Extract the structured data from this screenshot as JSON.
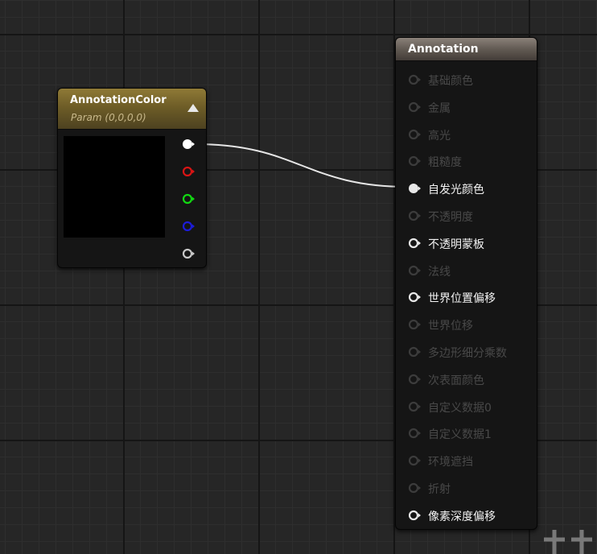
{
  "param_node": {
    "title": "AnnotationColor",
    "subtitle": "Param (0,0,0,0)",
    "preview_color": "#000000",
    "output_pins": [
      {
        "name": "rgba",
        "color": "#ffffff"
      },
      {
        "name": "r",
        "color": "#d81414"
      },
      {
        "name": "g",
        "color": "#12d812"
      },
      {
        "name": "b",
        "color": "#1c1cd8"
      },
      {
        "name": "a",
        "color": "#c8c8c8"
      }
    ]
  },
  "result_node": {
    "title": "Annotation",
    "inputs": [
      {
        "label": "基础颜色",
        "state": "disabled"
      },
      {
        "label": "金属",
        "state": "disabled"
      },
      {
        "label": "高光",
        "state": "disabled"
      },
      {
        "label": "粗糙度",
        "state": "disabled"
      },
      {
        "label": "自发光颜色",
        "state": "connected"
      },
      {
        "label": "不透明度",
        "state": "disabled"
      },
      {
        "label": "不透明蒙板",
        "state": "enabled"
      },
      {
        "label": "法线",
        "state": "disabled"
      },
      {
        "label": "世界位置偏移",
        "state": "enabled"
      },
      {
        "label": "世界位移",
        "state": "disabled"
      },
      {
        "label": "多边形细分乘数",
        "state": "disabled"
      },
      {
        "label": "次表面颜色",
        "state": "disabled"
      },
      {
        "label": "自定义数据0",
        "state": "disabled"
      },
      {
        "label": "自定义数据1",
        "state": "disabled"
      },
      {
        "label": "环境遮挡",
        "state": "disabled"
      },
      {
        "label": "折射",
        "state": "disabled"
      },
      {
        "label": "像素深度偏移",
        "state": "enabled"
      }
    ]
  },
  "colors": {
    "wire": "#e6e6e6",
    "pin_active": "#e8e8e8",
    "pin_disabled": "#3c3c3c"
  }
}
